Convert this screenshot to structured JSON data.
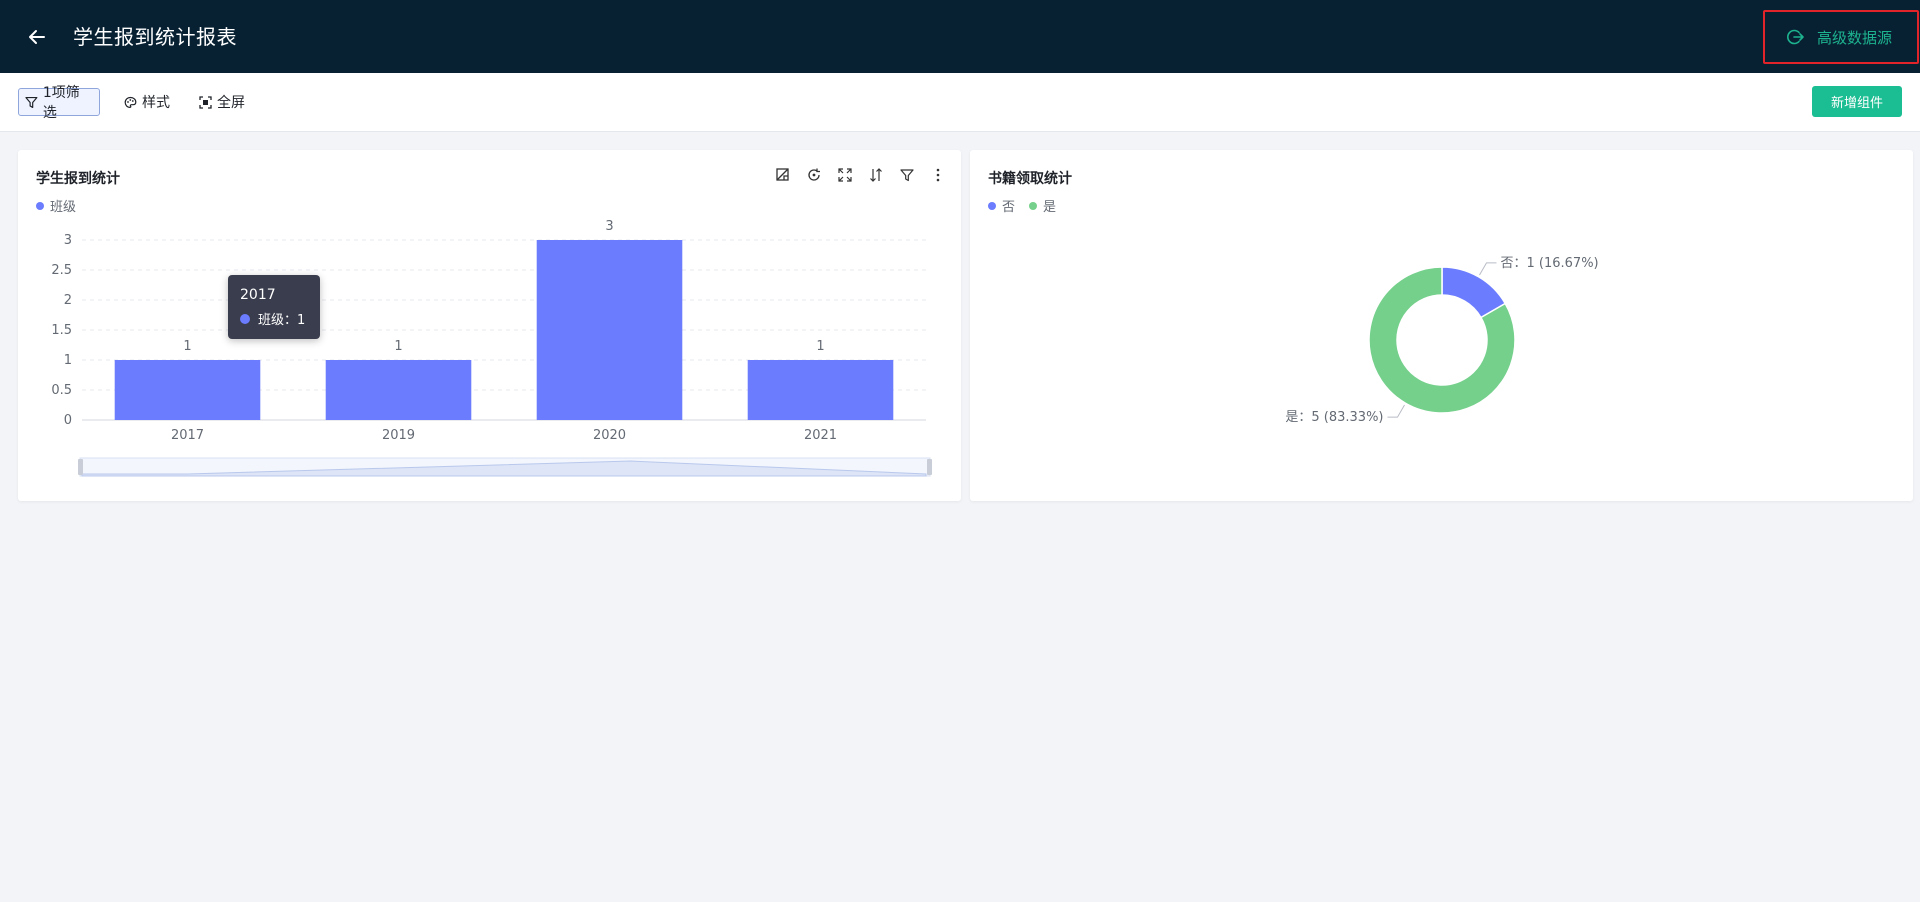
{
  "header": {
    "title": "学生报到统计报表",
    "advanced_source_label": "高级数据源"
  },
  "toolbar": {
    "filter_label": "1项筛选",
    "style_label": "样式",
    "fullscreen_label": "全屏",
    "add_widget_label": "新增组件"
  },
  "colors": {
    "header_bg": "#072133",
    "accent": "#1bbd92",
    "bar": "#6b7cff",
    "pie_no": "#6b7cff",
    "pie_yes": "#74d08b",
    "highlight_border": "#e0242a"
  },
  "left_card": {
    "title": "学生报到统计",
    "legend": [
      "班级"
    ],
    "tools": [
      "chart-type-icon",
      "refresh-icon",
      "expand-icon",
      "sort-icon",
      "filter-icon",
      "more-icon"
    ],
    "tooltip": {
      "title": "2017",
      "series": "班级",
      "value": "班级：1"
    }
  },
  "right_card": {
    "title": "书籍领取统计",
    "legend": [
      "否",
      "是"
    ]
  },
  "chart_data": [
    {
      "type": "bar",
      "title": "学生报到统计",
      "categories": [
        "2017",
        "2019",
        "2020",
        "2021"
      ],
      "series": [
        {
          "name": "班级",
          "values": [
            1,
            1,
            3,
            1
          ]
        }
      ],
      "ylim": [
        0,
        3
      ],
      "yticks": [
        "0",
        "0.5",
        "1",
        "1.5",
        "2",
        "2.5",
        "3"
      ],
      "data_labels": [
        "1",
        "1",
        "3",
        "1"
      ],
      "grid": true,
      "legend_position": "top-left"
    },
    {
      "type": "pie",
      "title": "书籍领取统计",
      "donut": true,
      "slices": [
        {
          "name": "否",
          "value": 1,
          "percent": 16.67,
          "label": "否：1 (16.67%)"
        },
        {
          "name": "是",
          "value": 5,
          "percent": 83.33,
          "label": "是：5 (83.33%)"
        }
      ],
      "legend_position": "top-left"
    }
  ]
}
